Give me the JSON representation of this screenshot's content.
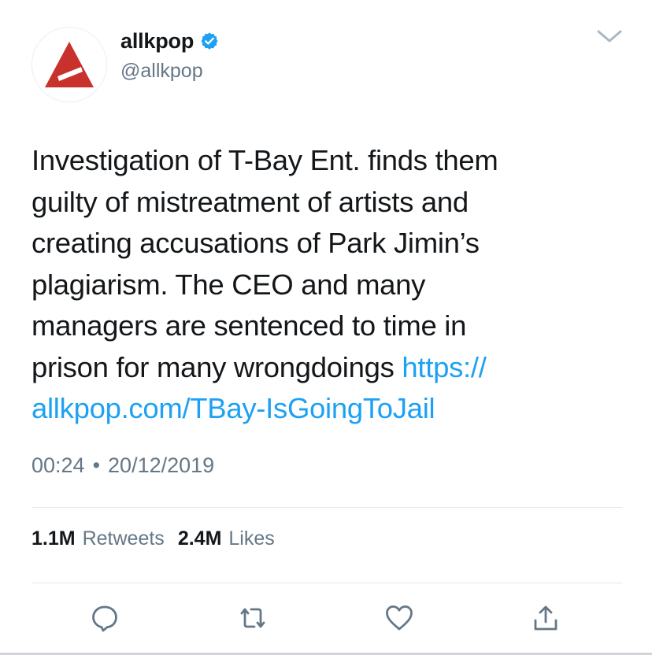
{
  "author": {
    "name": "allkpop",
    "handle": "@allkpop",
    "verified": true,
    "avatar_icon": "allkpop-logo-icon"
  },
  "tweet": {
    "text_lines": [
      "Investigation of T-Bay Ent. finds them",
      "guilty of mistreatment of artists and",
      "creating accusations of Park Jimin’s",
      "plagiarism. The CEO and many",
      "managers are sentenced to time in"
    ],
    "last_line_text": "prison for many wrongdoings ",
    "link_part1": "https://",
    "link_part2": "allkpop.com/TBay-IsGoingToJail",
    "time": "00:24",
    "separator": "•",
    "date": "20/12/2019"
  },
  "stats": {
    "retweets_count": "1.1M",
    "retweets_label": "Retweets",
    "likes_count": "2.4M",
    "likes_label": "Likes"
  },
  "actions": [
    "reply-icon",
    "retweet-icon",
    "like-icon",
    "share-icon"
  ],
  "colors": {
    "text": "#14171a",
    "secondary": "#657786",
    "link": "#1da1f2",
    "verified": "#1da1f2",
    "brand_red": "#c8312c",
    "divider": "#e1e8ed"
  }
}
